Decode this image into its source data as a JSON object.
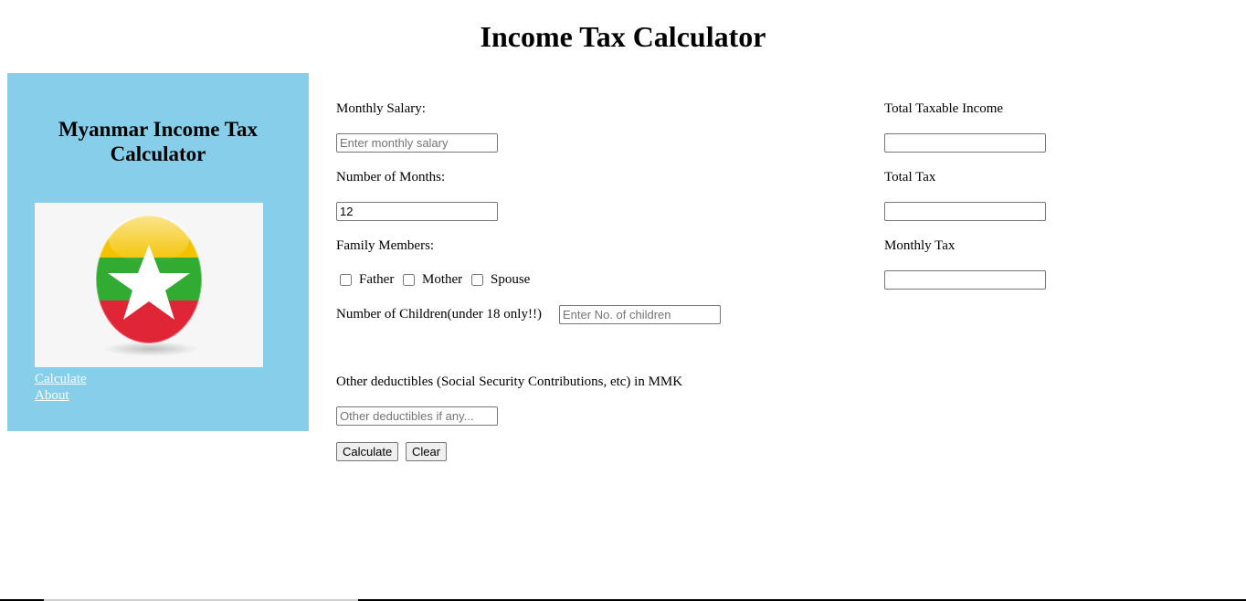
{
  "page": {
    "title": "Income Tax Calculator"
  },
  "sidebar": {
    "title": "Myanmar Income Tax Calculator",
    "links": [
      {
        "label": "Calculate"
      },
      {
        "label": "About"
      }
    ]
  },
  "form": {
    "salary": {
      "label": "Monthly Salary:",
      "placeholder": "Enter monthly salary",
      "value": ""
    },
    "months": {
      "label": "Number of Months:",
      "value": "12"
    },
    "family": {
      "label": "Family Members:",
      "options": [
        {
          "label": "Father",
          "checked": false
        },
        {
          "label": "Mother",
          "checked": false
        },
        {
          "label": "Spouse",
          "checked": false
        }
      ]
    },
    "children": {
      "label": "Number of Children(under 18 only!!)",
      "placeholder": "Enter No. of children"
    },
    "deductibles": {
      "label": "Other deductibles (Social Security Contributions, etc) in MMK",
      "placeholder": "Other deductibles if any..."
    },
    "calculate_label": "Calculate",
    "clear_label": "Clear"
  },
  "results": {
    "taxable_label": "Total Taxable Income",
    "taxable_value": "",
    "total_tax_label": "Total Tax",
    "total_tax_value": "",
    "monthly_tax_label": "Monthly Tax",
    "monthly_tax_value": ""
  },
  "colors": {
    "sidebar_bg": "#87ceeb",
    "flag_yellow": "#fecb00",
    "flag_green": "#34b233",
    "flag_red": "#ea2839"
  },
  "icons": {
    "logo": "myanmar-flag-icon"
  }
}
